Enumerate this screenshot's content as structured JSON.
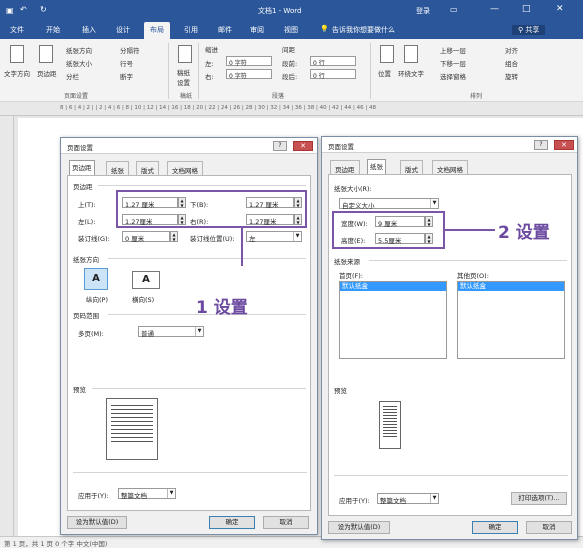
{
  "word": {
    "title": "文档1 - Word",
    "login": "登录",
    "tabs": [
      "文件",
      "开始",
      "插入",
      "设计",
      "布局",
      "引用",
      "邮件",
      "审阅",
      "视图"
    ],
    "tell_me": "告诉我你想要做什么",
    "share": "共享",
    "ribbon": {
      "text_direction": "文字方向",
      "margins": "页边距",
      "orientation": "纸张方向",
      "size": "纸张大小",
      "columns": "分栏",
      "breaks": "分隔符",
      "line_numbers": "行号",
      "hyphenation": "断字",
      "page_setup_group": "页面设置",
      "draft": "稿纸\n设置",
      "draft_group": "稿纸",
      "indent": "缩进",
      "spacing": "间距",
      "left_label": "左:",
      "left_val": "0 字符",
      "right_label": "右:",
      "right_val": "0 字符",
      "before_label": "段前:",
      "before_val": "0 行",
      "after_label": "段后:",
      "after_val": "0 行",
      "paragraph_group": "段落",
      "position": "位置",
      "wrap": "环绕文字",
      "forward": "上移一层",
      "backward": "下移一层",
      "selection_pane": "选择窗格",
      "align": "对齐",
      "group": "组合",
      "rotate": "旋转",
      "arrange_group": "排列"
    },
    "ruler_text": "8 | 6 | 4 | 2 |   | 2 | 4 | 6 | 8 | 10 | 12 | 14 | 16 | 18 | 20 | 22 | 24 | 26 | 28 | 30 | 32 | 34 | 36 | 38 | 40 | 42 | 44 | 46 | 48",
    "status": "第 1 页，共 1 页    0 个字    中文(中国)"
  },
  "dialog1": {
    "title": "页面设置",
    "tabs": [
      "页边距",
      "纸张",
      "版式",
      "文档网格"
    ],
    "margins_section": "页边距",
    "top_label": "上(T):",
    "top_val": "1.27 厘米",
    "bottom_label": "下(B):",
    "bottom_val": "1.27 厘米",
    "left_label": "左(L):",
    "left_val": "1.27厘米",
    "right_label": "右(R):",
    "right_val": "1.27厘米",
    "gutter_label": "装订线(G):",
    "gutter_val": "0 厘米",
    "gutter_pos_label": "装订线位置(U):",
    "gutter_pos_val": "左",
    "orientation_section": "纸张方向",
    "portrait": "纵向(P)",
    "landscape": "横向(S)",
    "pages_section": "页码范围",
    "multiple_label": "多页(M):",
    "multiple_val": "普通",
    "preview_section": "预览",
    "apply_label": "应用于(Y):",
    "apply_val": "整篇文档",
    "default_btn": "设为默认值(D)",
    "ok": "确定",
    "cancel": "取消"
  },
  "dialog2": {
    "title": "页面设置",
    "tabs": [
      "页边距",
      "纸张",
      "版式",
      "文档网格"
    ],
    "size_section": "纸张大小(R):",
    "size_val": "自定义大小",
    "width_label": "宽度(W):",
    "width_val": "9 厘米",
    "height_label": "高度(E):",
    "height_val": "5.5厘米",
    "source_section": "纸张来源",
    "first_label": "首页(F):",
    "first_item": "默认纸盒",
    "other_label": "其他页(O):",
    "other_item": "默认纸盒",
    "preview_section": "预览",
    "apply_label": "应用于(Y):",
    "apply_val": "整篇文档",
    "print_btn": "打印选项(T)...",
    "default_btn": "设为默认值(D)",
    "ok": "确定",
    "cancel": "取消"
  },
  "callouts": {
    "one": "1 设置",
    "two": "2 设置"
  },
  "colors": {
    "word_blue": "#2b579a",
    "highlight": "#7b56a7",
    "selected": "#3399ff"
  }
}
